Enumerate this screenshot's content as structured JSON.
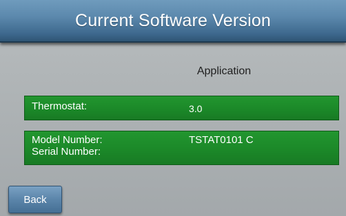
{
  "header": {
    "title": "Current Software Version"
  },
  "main": {
    "column_heading": "Application",
    "thermostat_row": {
      "label": "Thermostat:",
      "value": "3.0"
    },
    "model_row": {
      "model_label": "Model Number:",
      "model_value": "TSTAT0101  C",
      "serial_label": "Serial Number:",
      "serial_value": ""
    }
  },
  "footer": {
    "back_label": "Back"
  },
  "colors": {
    "title_bar": "#5c89ad",
    "panel_green": "#1d8a2b",
    "background": "#b0b5b7",
    "button": "#5b85aa"
  }
}
